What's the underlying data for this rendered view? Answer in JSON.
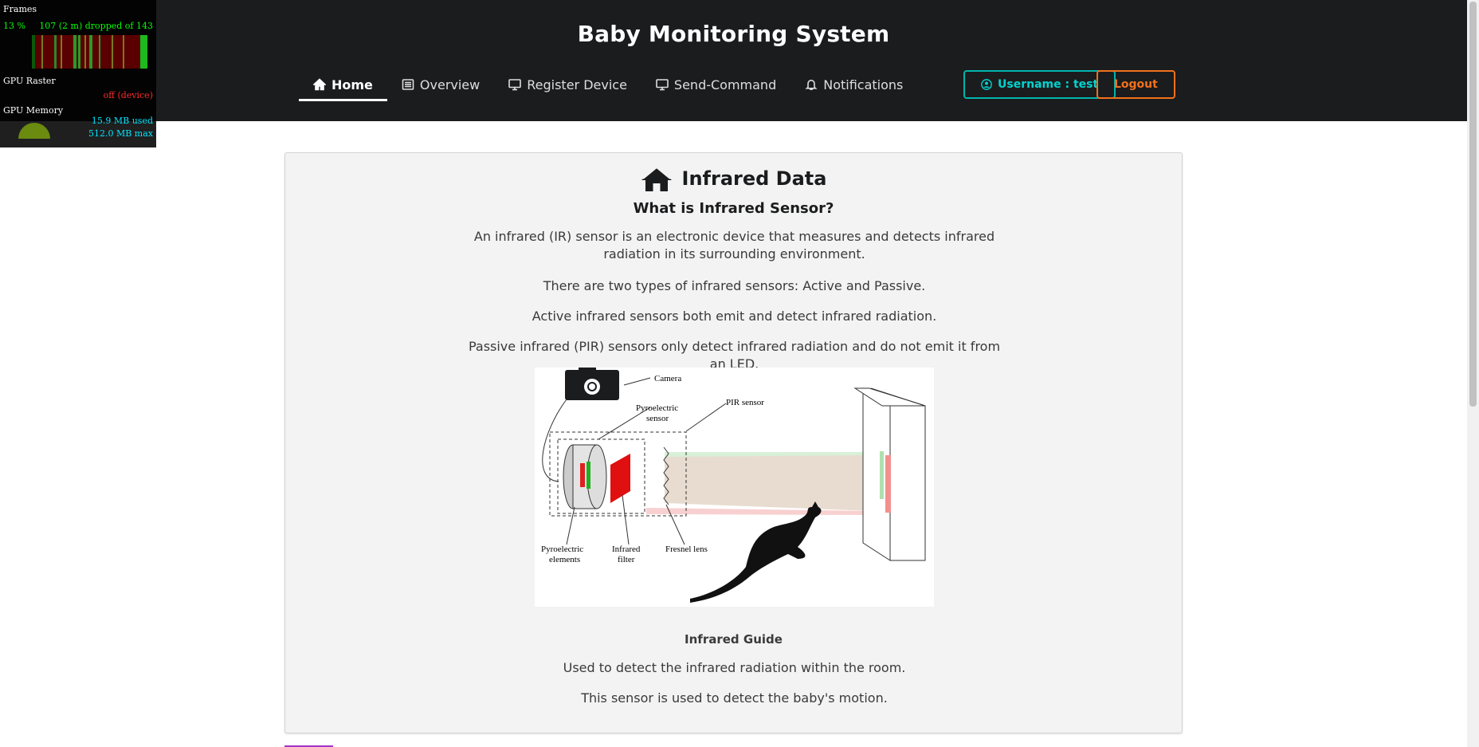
{
  "header": {
    "title": "Baby Monitoring System",
    "nav": [
      {
        "label": "Home",
        "icon": "home-icon",
        "active": true
      },
      {
        "label": "Overview",
        "icon": "list-icon",
        "active": false
      },
      {
        "label": "Register Device",
        "icon": "desktop-icon",
        "active": false
      },
      {
        "label": "Send-Command",
        "icon": "desktop-icon",
        "active": false
      },
      {
        "label": "Notifications",
        "icon": "bell-icon",
        "active": false
      }
    ],
    "user_button": "Username : test",
    "logout_button": "Logout",
    "colors": {
      "bar": "#1b1c1d",
      "user_accent": "#00b5ad",
      "logout_accent": "#f2711c"
    }
  },
  "perf_overlay": {
    "frames_label": "Frames",
    "frames_pct": "13 %",
    "frames_dropped": "107 (2 m) dropped of 143",
    "gpu_raster_label": "GPU Raster",
    "gpu_raster_status": "off (device)",
    "gpu_memory_label": "GPU Memory",
    "gpu_memory_used": "15.9 MB used",
    "gpu_memory_max": "512.0 MB max"
  },
  "content": {
    "title": "Infrared Data",
    "title_icon": "home-icon",
    "subtitle": "What is Infrared Sensor?",
    "paragraphs": [
      "An infrared (IR) sensor is an electronic device that measures and detects infrared radiation in its surrounding environment.",
      "There are two types of infrared sensors: Active and Passive.",
      "Active infrared sensors both emit and detect infrared radiation.",
      "Passive infrared (PIR) sensors only detect infrared radiation and do not emit it from an LED."
    ],
    "diagram": {
      "labels": {
        "camera": "Camera",
        "pyro_sensor_1": "Pyroelectric",
        "pyro_sensor_2": "sensor",
        "pir": "PIR sensor",
        "pyro_el_1": "Pyroelectric",
        "pyro_el_2": "elements",
        "filter_1": "Infrared",
        "filter_2": "filter",
        "fresnel": "Fresnel lens"
      }
    },
    "caption": "Infrared Guide",
    "caption_lines": [
      "Used to detect the infrared radiation within the room.",
      "This sensor is used to detect the baby's motion."
    ]
  }
}
